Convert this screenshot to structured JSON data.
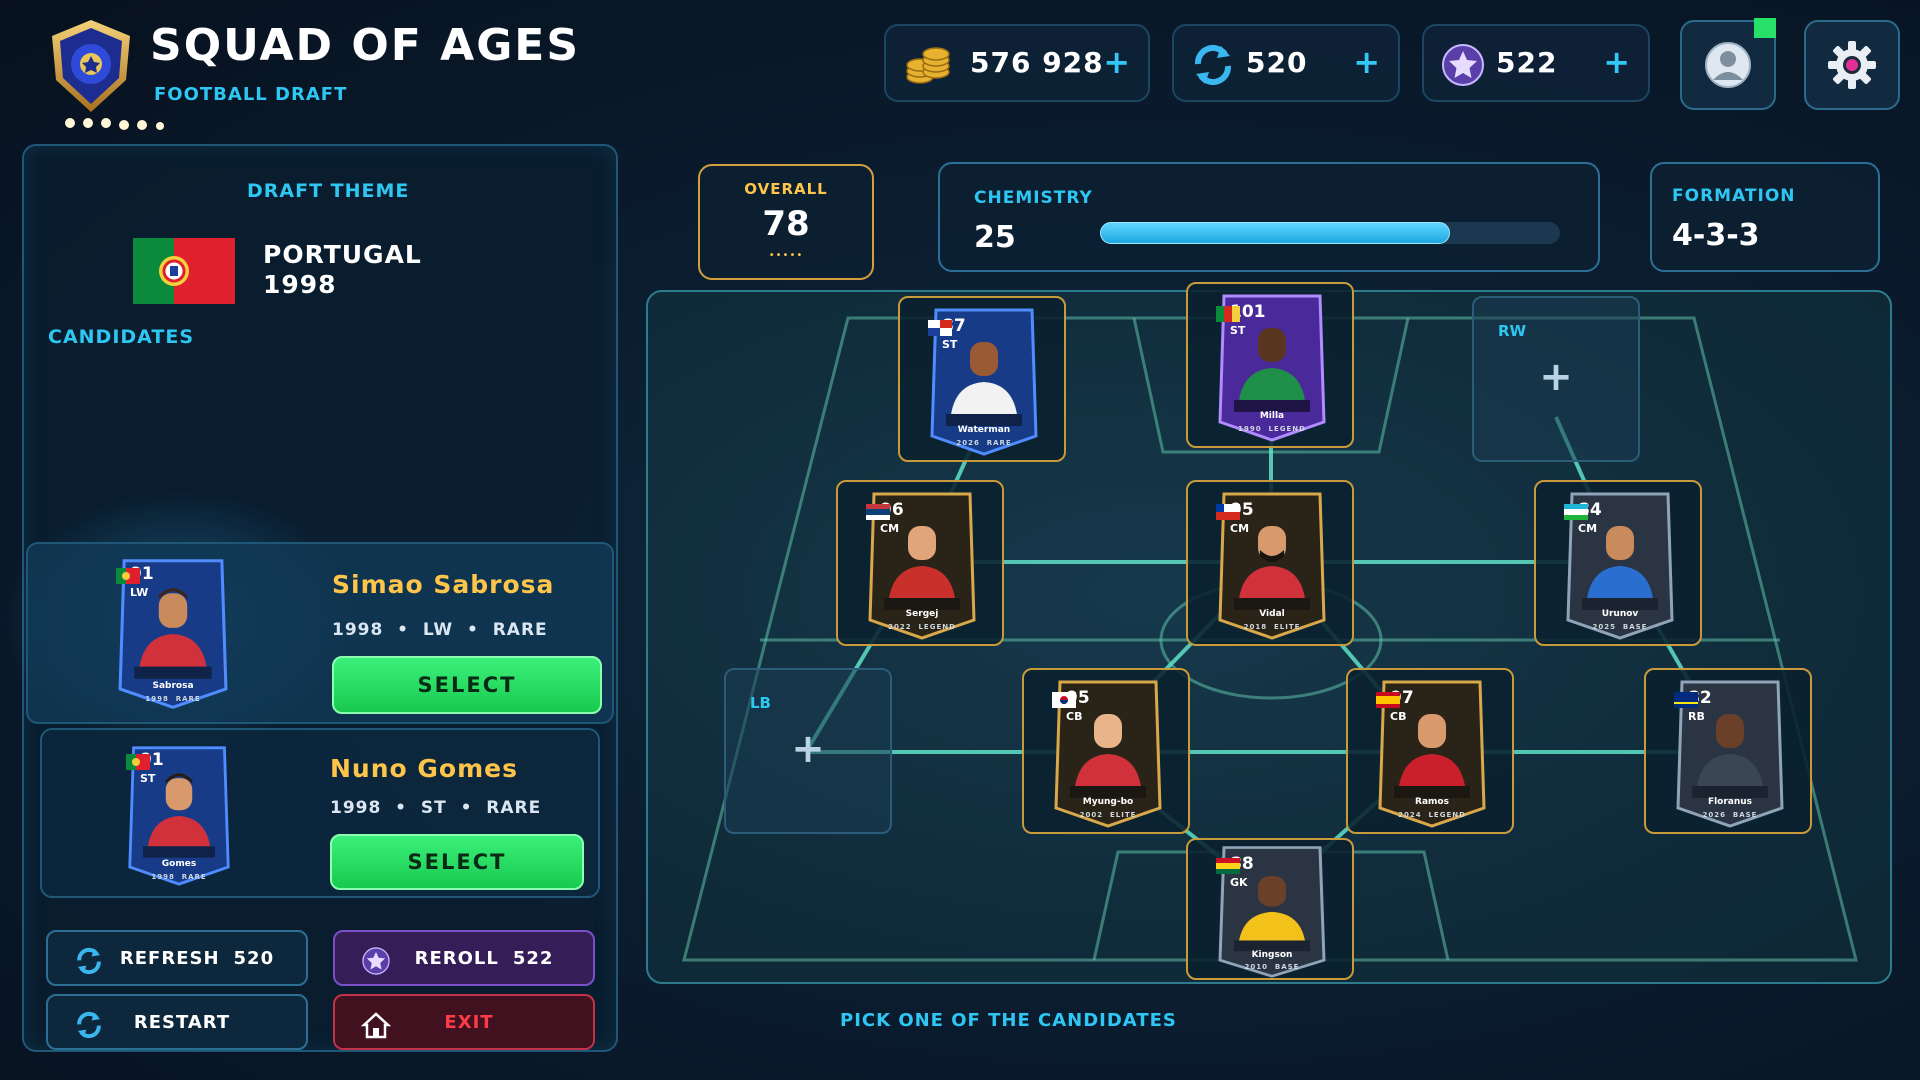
{
  "header": {
    "title": "SQUAD OF AGES",
    "subtitle": "FOOTBALL DRAFT"
  },
  "currencies": [
    {
      "icon": "coins-icon",
      "value": "576 928",
      "plus": "+"
    },
    {
      "icon": "refresh-token-icon",
      "value": "520",
      "plus": "+"
    },
    {
      "icon": "star-token-icon",
      "value": "522",
      "plus": "+"
    }
  ],
  "top_buttons": {
    "profile": "profile-icon",
    "settings": "gear-icon"
  },
  "draft": {
    "theme_label": "DRAFT THEME",
    "theme_country": "PORTUGAL",
    "theme_year": "1998",
    "candidates_label": "CANDIDATES",
    "candidates": [
      {
        "name": "Simao Sabrosa",
        "year": "1998",
        "position": "LW",
        "rarity": "RARE",
        "rating": "91",
        "card_name": "Sabrosa",
        "card_year": "1998",
        "card_rarity": "RARE",
        "select": "SELECT"
      },
      {
        "name": "Nuno Gomes",
        "year": "1998",
        "position": "ST",
        "rarity": "RARE",
        "rating": "91",
        "card_name": "Gomes",
        "card_year": "1998",
        "card_rarity": "RARE",
        "select": "SELECT"
      }
    ],
    "sep": "•"
  },
  "actions": {
    "refresh": {
      "label": "REFRESH",
      "count": "520"
    },
    "reroll": {
      "label": "REROLL",
      "count": "522"
    },
    "restart": {
      "label": "RESTART"
    },
    "exit": {
      "label": "EXIT"
    }
  },
  "stats": {
    "overall_label": "OVERALL",
    "overall_value": "78",
    "overall_dots": "•••••",
    "chemistry_label": "CHEMISTRY",
    "chemistry_value": "25",
    "chemistry_fill": 0.76,
    "formation_label": "FORMATION",
    "formation_value": "4-3-3"
  },
  "squad": {
    "st_left": {
      "rating": "87",
      "position": "ST",
      "name": "Waterman",
      "year": "2026",
      "rarity": "RARE"
    },
    "st": {
      "rating": "101",
      "position": "ST",
      "name": "Milla",
      "year": "1990",
      "rarity": "LEGEND"
    },
    "rw": {
      "position": "RW",
      "plus": "+"
    },
    "cm_left": {
      "rating": "96",
      "position": "CM",
      "name": "Sergej",
      "year": "2022",
      "rarity": "LEGEND"
    },
    "cm_center": {
      "rating": "95",
      "position": "CM",
      "name": "Vidal",
      "year": "2018",
      "rarity": "ELITE"
    },
    "cm_right": {
      "rating": "84",
      "position": "CM",
      "name": "Urunov",
      "year": "2025",
      "rarity": "BASE"
    },
    "lb": {
      "position": "LB",
      "plus": "+"
    },
    "cb_left": {
      "rating": "95",
      "position": "CB",
      "name": "Myung-bo",
      "year": "2002",
      "rarity": "ELITE"
    },
    "cb_right": {
      "rating": "97",
      "position": "CB",
      "name": "Ramos",
      "year": "2024",
      "rarity": "LEGEND"
    },
    "rb": {
      "rating": "82",
      "position": "RB",
      "name": "Floranus",
      "year": "2026",
      "rarity": "BASE"
    },
    "gk": {
      "rating": "88",
      "position": "GK",
      "name": "Kingson",
      "year": "2010",
      "rarity": "BASE"
    }
  },
  "hint": "PICK ONE OF THE CANDIDATES",
  "colors": {
    "accent": "#2ec6f2",
    "gold": "#ffc54a",
    "select_green": "#22d85a",
    "exit_red": "#ff3b4a",
    "reroll_purple": "#3a1d5c"
  }
}
